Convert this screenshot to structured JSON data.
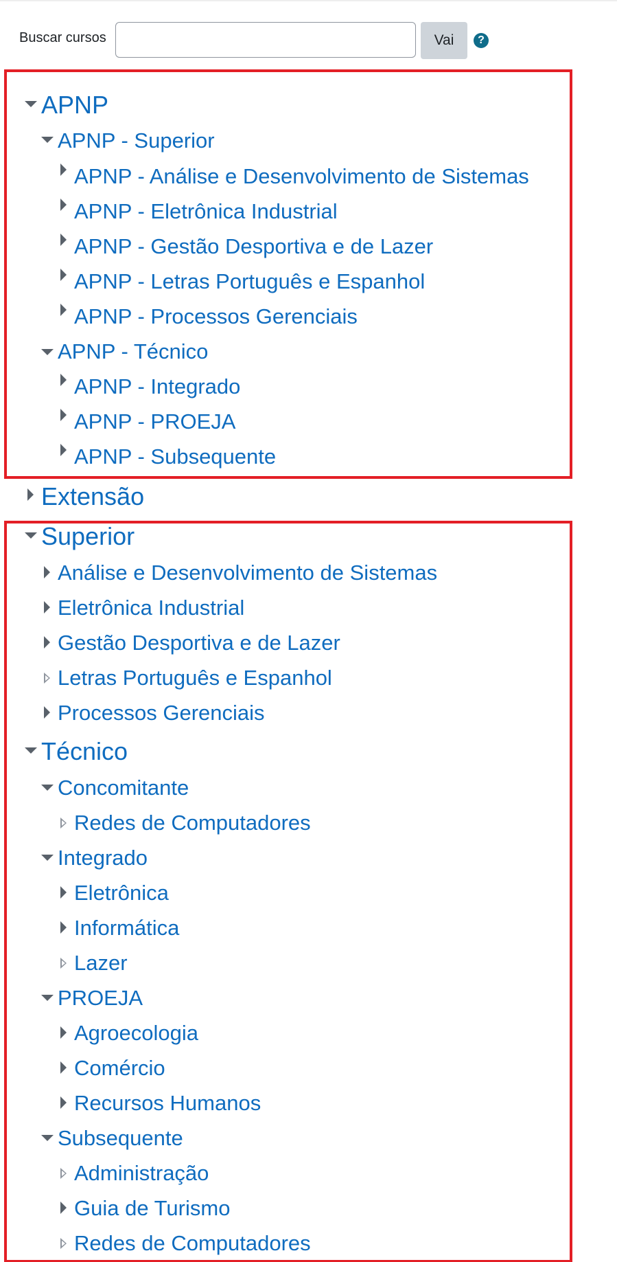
{
  "search": {
    "label": "Buscar cursos",
    "placeholder": "",
    "value": "",
    "button_label": "Vai",
    "help_icon": "question-circle-icon"
  },
  "colors": {
    "link": "#0f6cbf",
    "highlight_border": "#e31f26",
    "button_bg": "#ced4da",
    "help_icon": "#0f6c8a",
    "arrow": "#59616a"
  },
  "tree": {
    "apnp": "APNP",
    "apnp_superior": "APNP - Superior",
    "apnp_ads": "APNP - Análise e Desenvolvimento de Sistemas",
    "apnp_eletronica": "APNP - Eletrônica Industrial",
    "apnp_gestao": "APNP - Gestão Desportiva e de Lazer",
    "apnp_letras": "APNP - Letras Português e Espanhol",
    "apnp_processos": "APNP - Processos Gerenciais",
    "apnp_tecnico": "APNP - Técnico",
    "apnp_integrado": "APNP - Integrado",
    "apnp_proeja": "APNP - PROEJA",
    "apnp_subsequente": "APNP - Subsequente",
    "extensao": "Extensão",
    "superior": "Superior",
    "sup_ads": "Análise e Desenvolvimento de Sistemas",
    "sup_eletronica": "Eletrônica Industrial",
    "sup_gestao": "Gestão Desportiva e de Lazer",
    "sup_letras": "Letras Português e Espanhol",
    "sup_processos": "Processos Gerenciais",
    "tecnico": "Técnico",
    "concomitante": "Concomitante",
    "conc_redes": "Redes de Computadores",
    "integrado": "Integrado",
    "int_eletronica": "Eletrônica",
    "int_informatica": "Informática",
    "int_lazer": "Lazer",
    "proeja": "PROEJA",
    "proeja_agro": "Agroecologia",
    "proeja_comercio": "Comércio",
    "proeja_rh": "Recursos Humanos",
    "subsequente": "Subsequente",
    "sub_admin": "Administração",
    "sub_turismo": "Guia de Turismo",
    "sub_redes": "Redes de Computadores"
  }
}
